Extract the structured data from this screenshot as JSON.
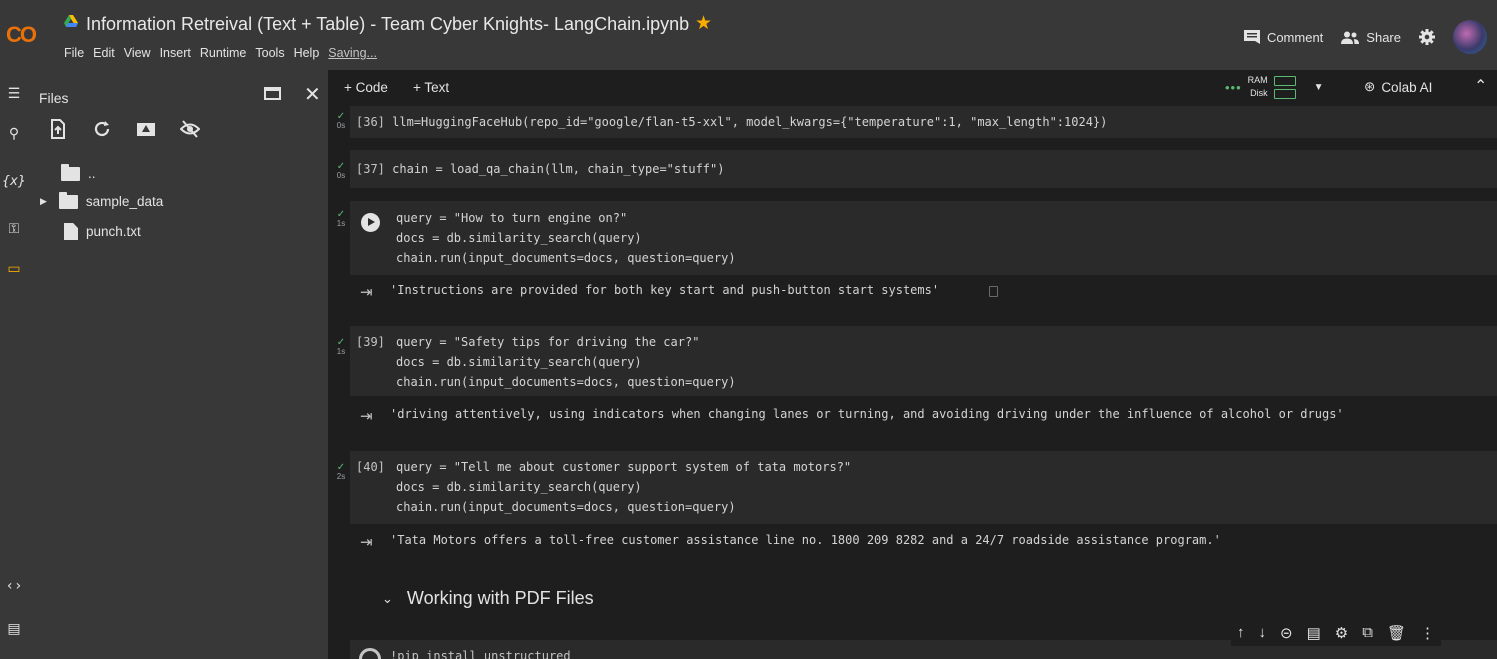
{
  "header": {
    "logo": "CO",
    "title": "Information Retreival (Text + Table) - Team Cyber Knights- LangChain.ipynb",
    "star": "★",
    "menu": [
      "File",
      "Edit",
      "View",
      "Insert",
      "Runtime",
      "Tools",
      "Help"
    ],
    "saving": "Saving...",
    "comment": "Comment",
    "share": "Share",
    "comment_icon": "comment-icon",
    "share_icon": "share-icon",
    "settings_icon": "gear-icon"
  },
  "files_panel": {
    "title": "Files",
    "tree": [
      {
        "label": "..",
        "type": "folder"
      },
      {
        "label": "sample_data",
        "type": "folder"
      },
      {
        "label": "punch.txt",
        "type": "file"
      }
    ]
  },
  "toolbar": {
    "add_code": "+ Code",
    "add_text": "+ Text",
    "ram": "RAM",
    "disk": "Disk",
    "colab_ai": "Colab AI"
  },
  "cells": [
    {
      "prompt": "[36]",
      "time": "0s",
      "lines": [
        "llm=HuggingFaceHub(repo_id=\"google/flan-t5-xxl\", model_kwargs={\"temperature\":1, \"max_length\":1024})"
      ]
    },
    {
      "prompt": "[37]",
      "time": "0s",
      "lines": [
        "chain = load_qa_chain(llm, chain_type=\"stuff\")"
      ]
    },
    {
      "prompt": "",
      "time": "1s",
      "lines": [
        "query = \"How to turn engine on?\"",
        "docs = db.similarity_search(query)",
        "chain.run(input_documents=docs, question=query)"
      ],
      "output": "'Instructions are provided for both key start and push-button start systems'"
    },
    {
      "prompt": "[39]",
      "time": "1s",
      "lines": [
        "query = \"Safety tips for driving the car?\"",
        "docs = db.similarity_search(query)",
        "chain.run(input_documents=docs, question=query)"
      ],
      "output": "'driving attentively, using indicators when changing lanes or turning, and avoiding driving under the influence of alcohol or drugs'"
    },
    {
      "prompt": "[40]",
      "time": "2s",
      "lines": [
        "query = \"Tell me about customer support system of tata motors?\"",
        "docs = db.similarity_search(query)",
        "chain.run(input_documents=docs, question=query)"
      ],
      "output": "'Tata Motors offers a toll-free customer assistance line no. 1800 209 8282 and a 24/7 roadside assistance program.'"
    }
  ],
  "section_heading": "Working with PDF Files",
  "last_cell_code": "!pip install unstructured"
}
